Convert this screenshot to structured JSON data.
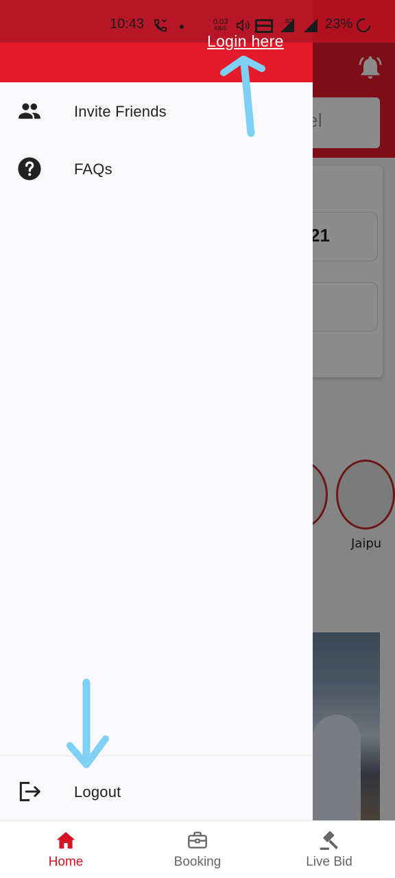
{
  "status_bar": {
    "time": "10:43",
    "speed_value": "0.03",
    "speed_unit": "KB/S",
    "network": "4G",
    "battery": "23%"
  },
  "annotation": {
    "login_text": "Login here",
    "arrow_color": "#7fd0f5"
  },
  "background": {
    "search_partial": "el",
    "date_partial": "21",
    "city_partial": "Jaipu"
  },
  "drawer": {
    "items": [
      {
        "label": "Invite Friends",
        "icon": "people-icon"
      },
      {
        "label": "FAQs",
        "icon": "help-circle-icon"
      }
    ],
    "logout": {
      "label": "Logout",
      "icon": "logout-icon"
    }
  },
  "bottom_nav": {
    "items": [
      {
        "label": "Home",
        "icon": "home-icon",
        "active": true
      },
      {
        "label": "Booking",
        "icon": "briefcase-icon",
        "active": false
      },
      {
        "label": "Live Bid",
        "icon": "gavel-icon",
        "active": false
      }
    ]
  },
  "colors": {
    "brand_red": "#e31b2b",
    "active_nav": "#d41424",
    "drawer_bg": "#f9f9fb"
  }
}
